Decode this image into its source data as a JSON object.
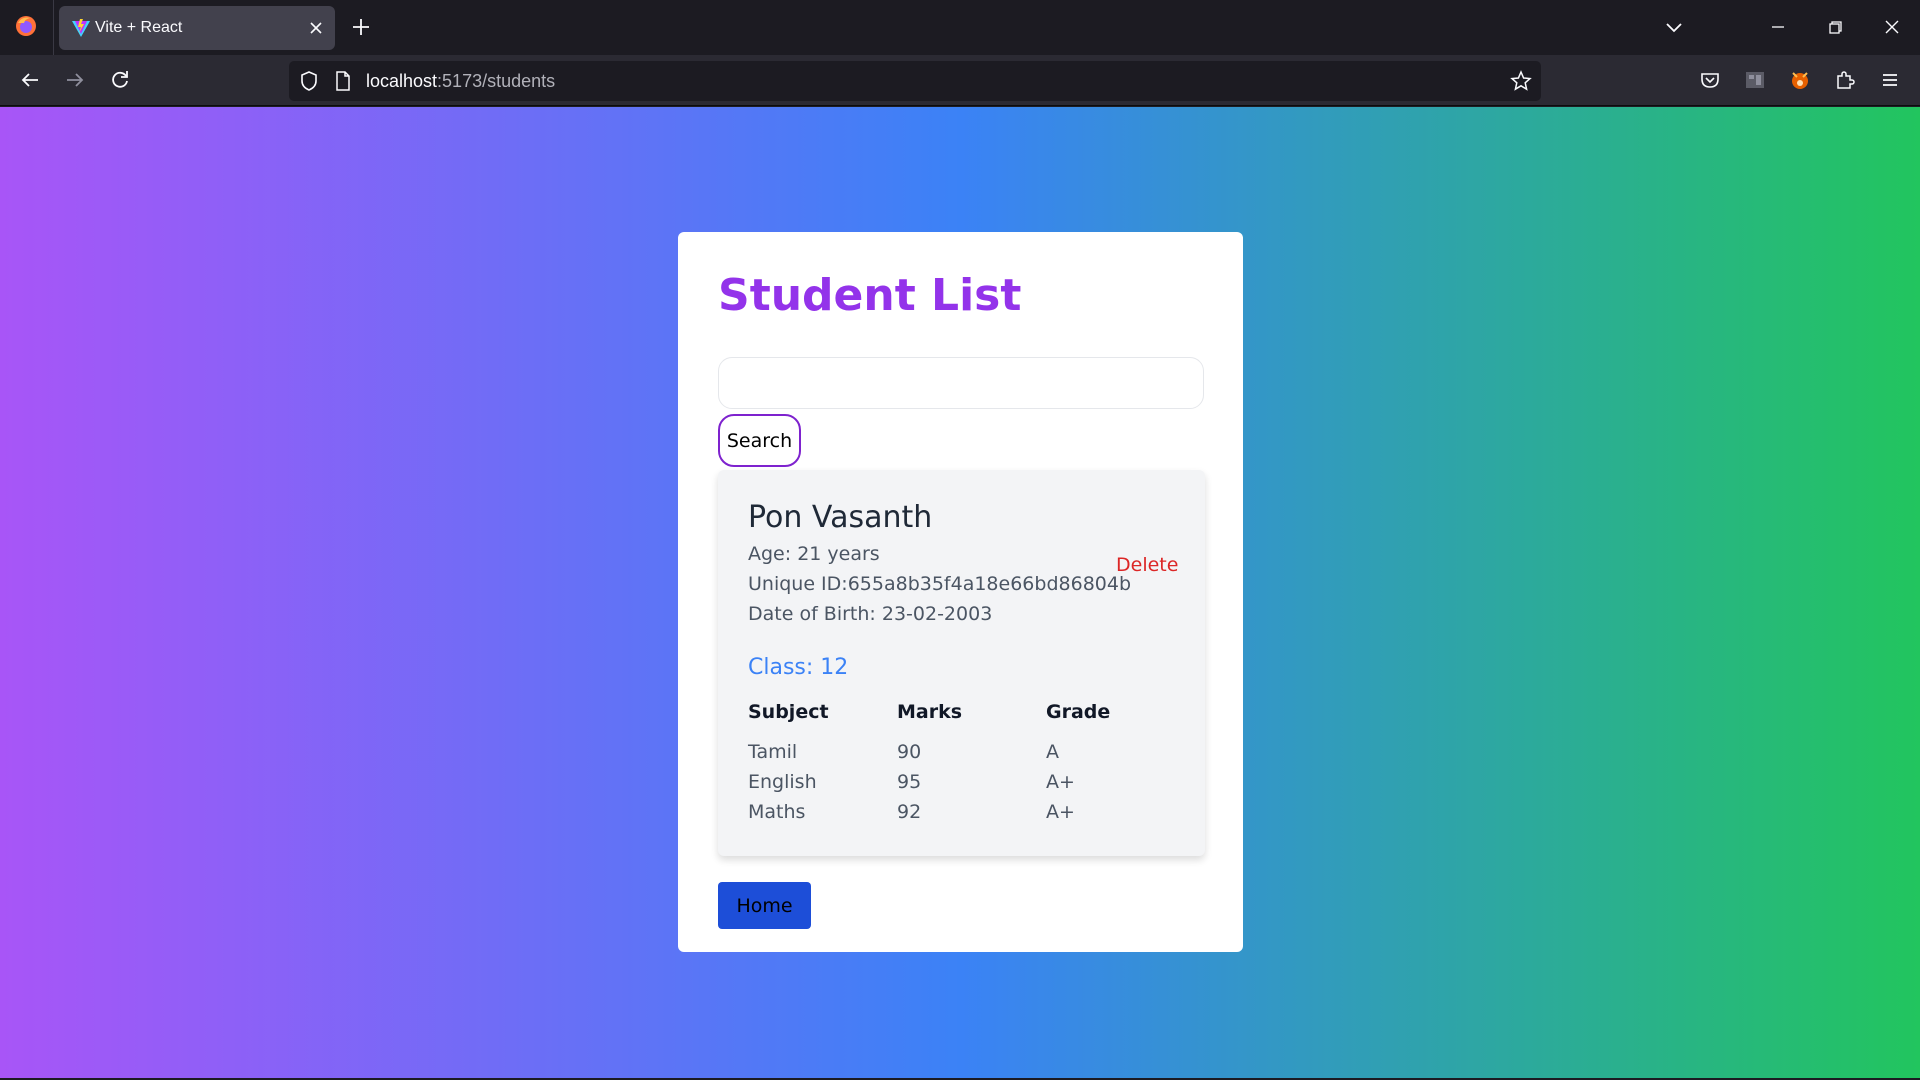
{
  "browser": {
    "tab_title": "Vite + React",
    "url_host": "localhost",
    "url_path": ":5173/students"
  },
  "page": {
    "title": "Student List",
    "search_value": "",
    "search_button": "Search",
    "home_button": "Home"
  },
  "student": {
    "name": "Pon Vasanth",
    "age": "Age: 21 years",
    "unique_id": "Unique ID:655a8b35f4a18e66bd86804b",
    "dob": "Date of Birth: 23-02-2003",
    "delete_label": "Delete",
    "class_label": "Class: 12",
    "table": {
      "headers": [
        "Subject",
        "Marks",
        "Grade"
      ],
      "rows": [
        [
          "Tamil",
          "90",
          "A"
        ],
        [
          "English",
          "95",
          "A+"
        ],
        [
          "Maths",
          "92",
          "A+"
        ]
      ]
    }
  },
  "colors": {
    "title": "#9333ea",
    "delete": "#dc2626",
    "class": "#3b82f6",
    "home_button": "#1d4ed8",
    "search_border": "#7e22ce",
    "gradient": [
      "#a855f7",
      "#3b82f6",
      "#22c55e"
    ]
  },
  "icons": {
    "browser_logo": "firefox-icon",
    "tab_favicon": "vite-icon",
    "tab_close": "close-icon",
    "new_tab": "plus-icon",
    "list_tabs": "chevron-down-icon",
    "back": "arrow-left-icon",
    "forward": "arrow-right-icon",
    "reload": "reload-icon",
    "tracking": "shield-icon",
    "page": "page-icon",
    "bookmark": "star-icon",
    "pocket": "pocket-icon",
    "extension1": "reader-icon",
    "extension2": "fox-extension-icon",
    "extensions": "puzzle-icon",
    "menu": "hamburger-icon",
    "minimize": "minimize-icon",
    "restore": "restore-icon",
    "close_window": "close-window-icon"
  }
}
